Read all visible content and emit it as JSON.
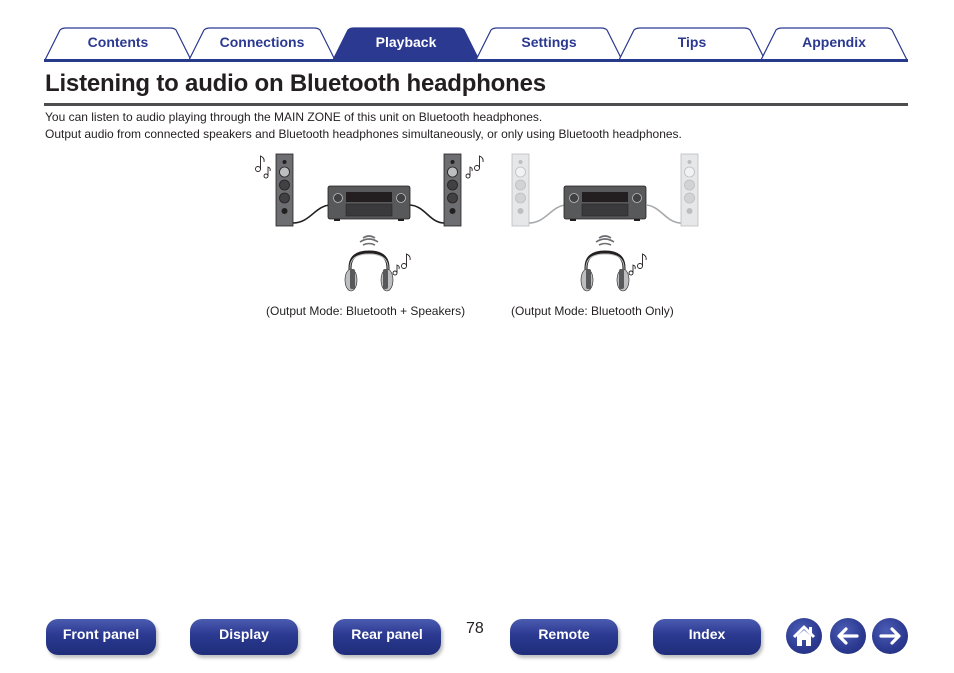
{
  "tabs": [
    {
      "label": "Contents",
      "active": false
    },
    {
      "label": "Connections",
      "active": false
    },
    {
      "label": "Playback",
      "active": true
    },
    {
      "label": "Settings",
      "active": false
    },
    {
      "label": "Tips",
      "active": false
    },
    {
      "label": "Appendix",
      "active": false
    }
  ],
  "page": {
    "title": "Listening to audio on Bluetooth headphones",
    "paragraphs": [
      "You can listen to audio playing through the MAIN ZONE of this unit on Bluetooth headphones.",
      "Output audio from connected speakers and Bluetooth headphones simultaneously, or only using Bluetooth headphones."
    ]
  },
  "illustrations": [
    {
      "caption": "(Output Mode: Bluetooth + Speakers)",
      "speakers_active": true
    },
    {
      "caption": "(Output Mode: Bluetooth Only)",
      "speakers_active": false
    }
  ],
  "footer": {
    "buttons": [
      "Front panel",
      "Display",
      "Rear panel",
      "Remote",
      "Index"
    ],
    "page_number": "78",
    "icons": {
      "home": "home-icon",
      "back": "arrow-left-icon",
      "forward": "arrow-right-icon"
    }
  },
  "colors": {
    "brand": "#2b3990",
    "text": "#231f20",
    "rule": "#4d4d4f"
  }
}
